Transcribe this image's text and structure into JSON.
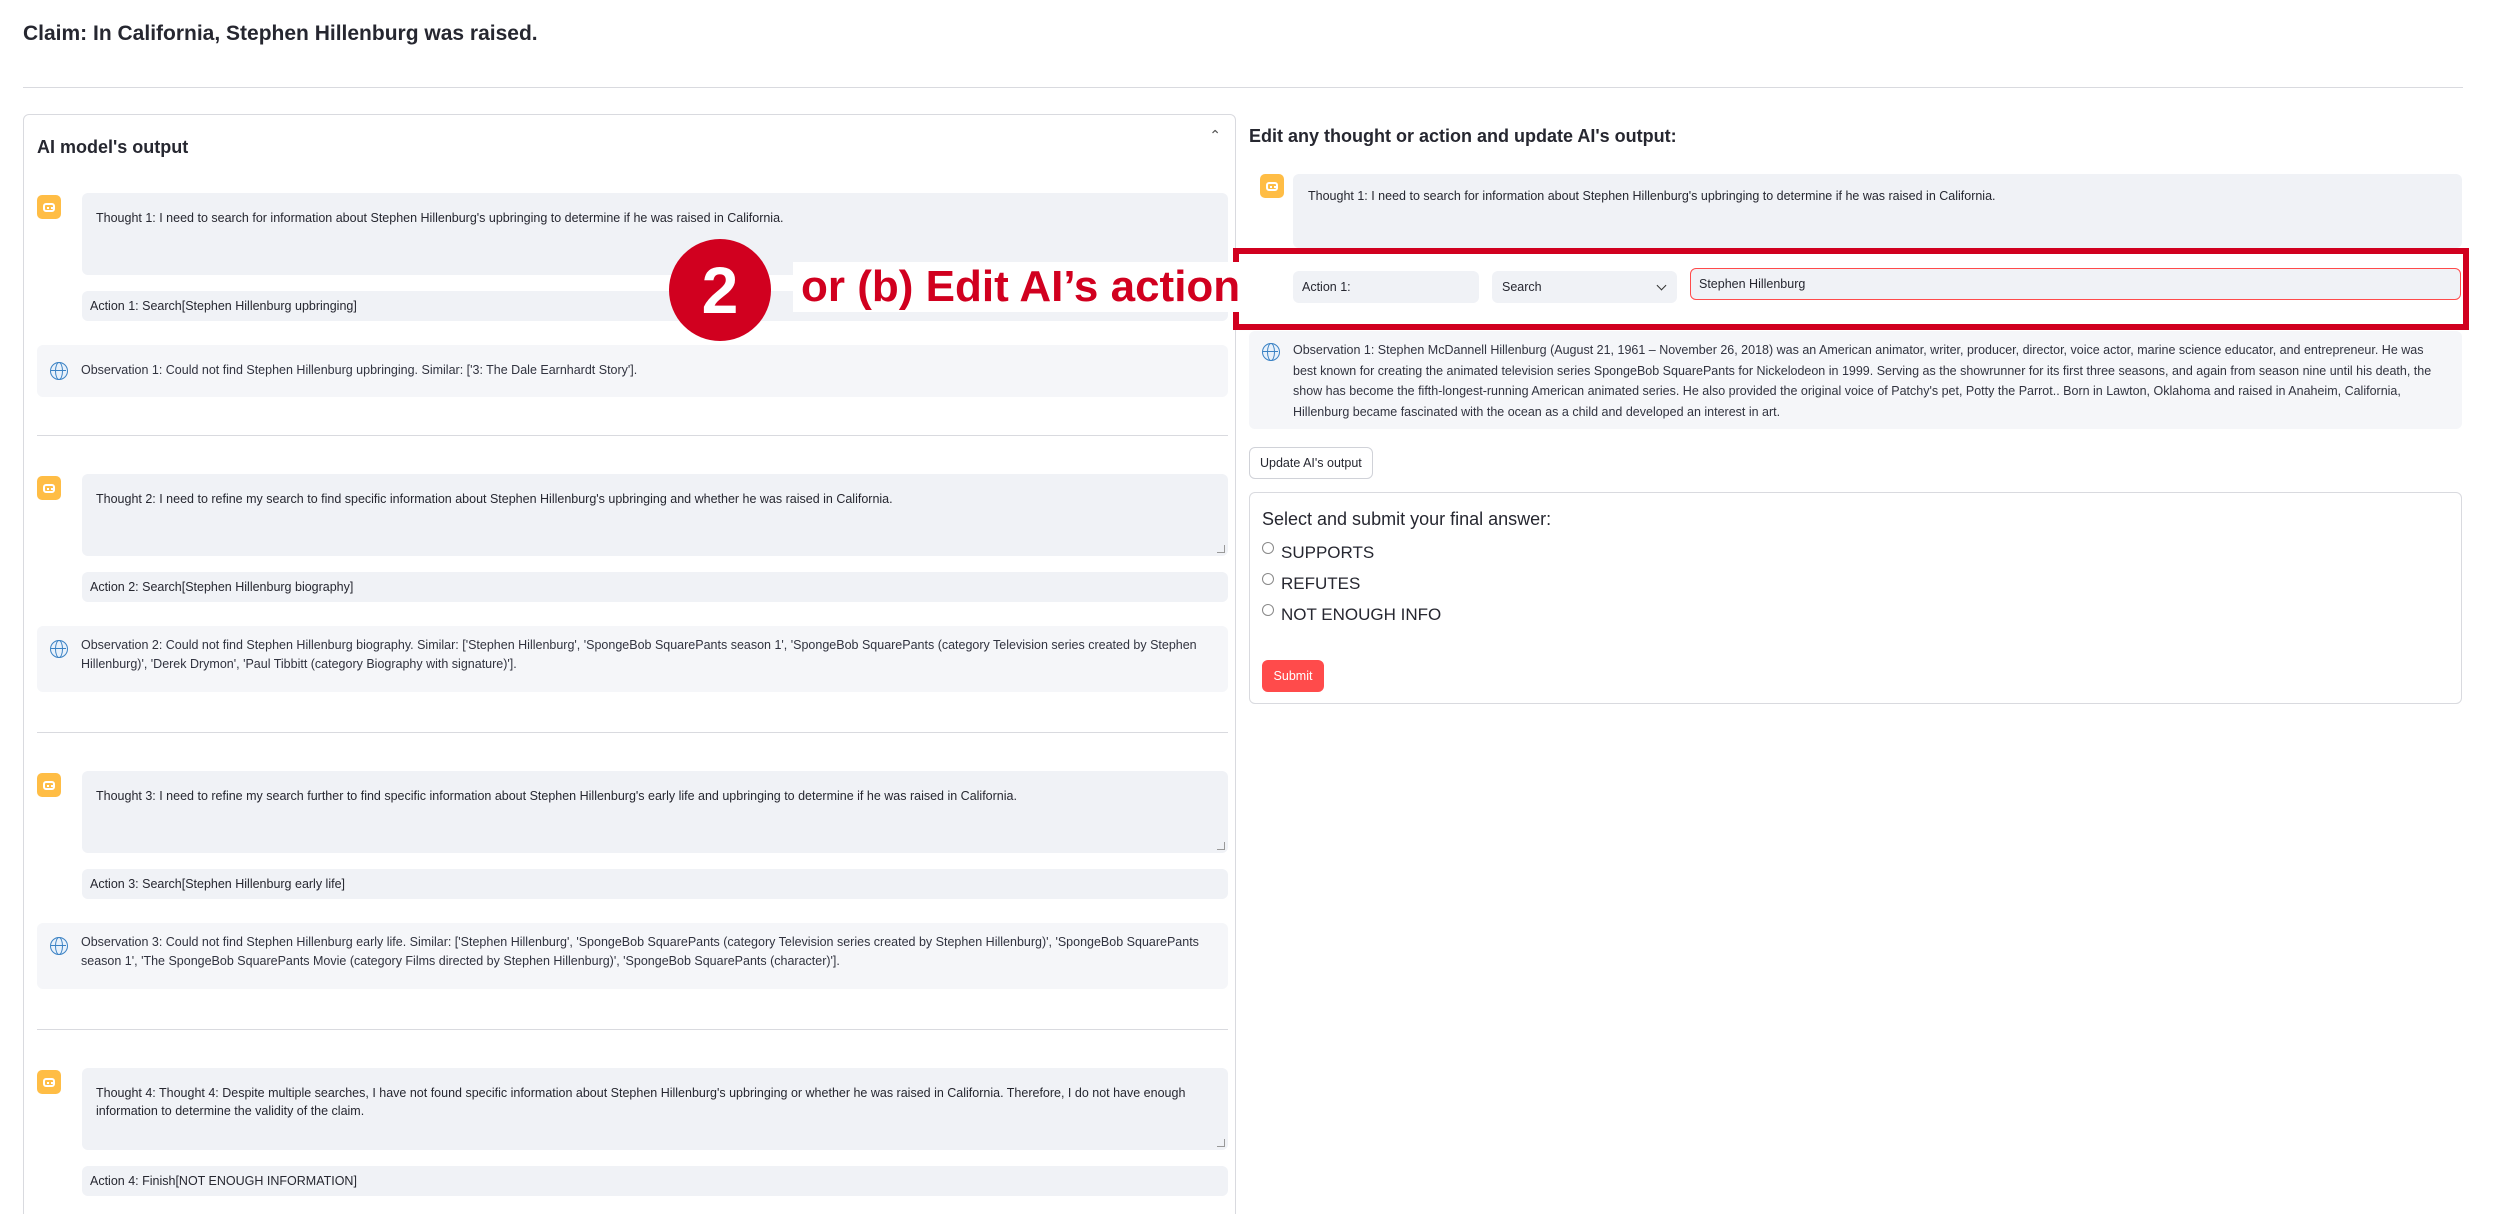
{
  "claim": "Claim: In California, Stephen Hillenburg was raised.",
  "left_panel": {
    "title": "AI model's output",
    "steps": [
      {
        "thought": "Thought 1: I need to search for information about Stephen Hillenburg's upbringing to determine if he was raised in California.",
        "action": "Action 1: Search[Stephen Hillenburg upbringing]",
        "observation": "Observation 1: Could not find Stephen Hillenburg upbringing. Similar: ['3: The Dale Earnhardt Story']."
      },
      {
        "thought": "Thought 2: I need to refine my search to find specific information about Stephen Hillenburg's upbringing and whether he was raised in California.",
        "action": "Action 2: Search[Stephen Hillenburg biography]",
        "observation": "Observation 2: Could not find Stephen Hillenburg biography. Similar: ['Stephen Hillenburg', 'SpongeBob SquarePants season 1', 'SpongeBob SquarePants (category Television series created by Stephen Hillenburg)', 'Derek Drymon', 'Paul Tibbitt (category Biography with signature)']."
      },
      {
        "thought": "Thought 3: I need to refine my search further to find specific information about Stephen Hillenburg's early life and upbringing to determine if he was raised in California.",
        "action": "Action 3: Search[Stephen Hillenburg early life]",
        "observation": "Observation 3: Could not find Stephen Hillenburg early life. Similar: ['Stephen Hillenburg', 'SpongeBob SquarePants (category Television series created by Stephen Hillenburg)', 'SpongeBob SquarePants season 1', 'The SpongeBob SquarePants Movie (category Films directed by Stephen Hillenburg)', 'SpongeBob SquarePants (character)']."
      },
      {
        "thought": "Thought 4: Thought 4: Despite multiple searches, I have not found specific information about Stephen Hillenburg's upbringing or whether he was raised in California. Therefore, I do not have enough information to determine the validity of the claim.",
        "action": "Action 4: Finish[NOT ENOUGH INFORMATION]"
      }
    ]
  },
  "right_panel": {
    "title": "Edit any thought or action and update AI's output:",
    "thought": "Thought 1: I need to search for information about Stephen Hillenburg's upbringing to determine if he was raised in California.",
    "action_label": "Action 1:",
    "action_type": "Search",
    "action_value": "Stephen Hillenburg",
    "observation": "Observation 1: Stephen McDannell Hillenburg (August 21, 1961 – November 26, 2018) was an American animator, writer, producer, director, voice actor, marine science educator, and entrepreneur. He was best known for creating the animated television series SpongeBob SquarePants for Nickelodeon in 1999. Serving as the showrunner for its first three seasons, and again from season nine until his death, the show has become the fifth-longest-running American animated series. He also provided the original voice of Patchy's pet, Potty the Parrot.. Born in Lawton, Oklahoma and raised in Anaheim, California, Hillenburg became fascinated with the ocean as a child and developed an interest in art.",
    "update_button": "Update AI's output",
    "final_answer": {
      "question": "Select and submit your final answer:",
      "options": [
        "SUPPORTS",
        "REFUTES",
        "NOT ENOUGH INFO"
      ],
      "submit": "Submit"
    }
  },
  "annotation": {
    "step_number": "2",
    "text": "or (b) Edit AI’s action"
  },
  "colors": {
    "accent": "#ff4b4b",
    "annotation_red": "#d1001f",
    "bot_icon": "#ffbd45",
    "box_bg": "#f0f2f6"
  }
}
